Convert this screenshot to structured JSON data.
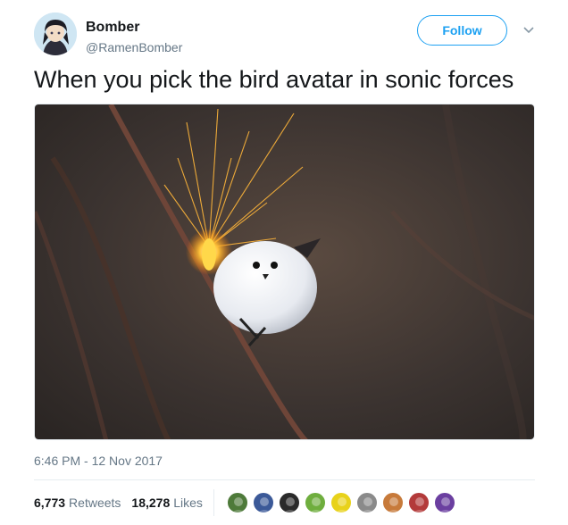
{
  "user": {
    "name": "Bomber",
    "handle": "@RamenBomber"
  },
  "header": {
    "follow_label": "Follow"
  },
  "tweet": {
    "text": "When you pick the bird avatar in sonic forces",
    "timestamp": "6:46 PM - 12 Nov 2017"
  },
  "stats": {
    "retweets_count": "6,773",
    "retweets_label": "Retweets",
    "likes_count": "18,278",
    "likes_label": "Likes"
  },
  "likers": [
    {
      "color": "#4e7a3a"
    },
    {
      "color": "#3b5998"
    },
    {
      "color": "#2a2a2a"
    },
    {
      "color": "#6fae3e"
    },
    {
      "color": "#e8d21a"
    },
    {
      "color": "#8a8a8a"
    },
    {
      "color": "#c77a3a"
    },
    {
      "color": "#b33a3a"
    },
    {
      "color": "#6b3fa0"
    }
  ],
  "colors": {
    "accent": "#1da1f2",
    "text": "#14171a",
    "secondary": "#657786"
  }
}
